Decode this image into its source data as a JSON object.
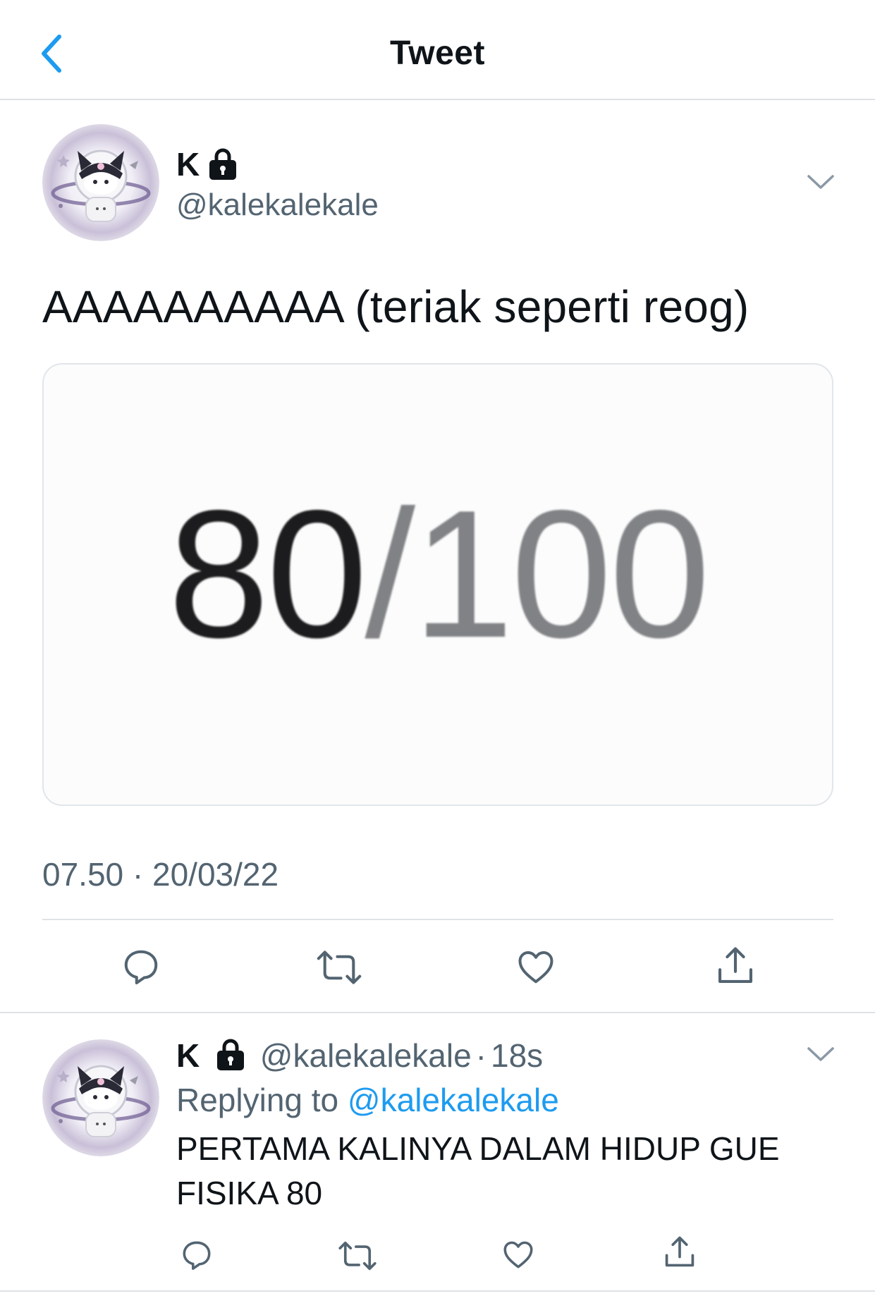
{
  "header": {
    "title": "Tweet",
    "back_icon": "chevron-left-icon"
  },
  "main_tweet": {
    "display_name": "K",
    "handle": "@kalekalekale",
    "text": "AAAAAAAAAA (teriak seperti reog)",
    "media": {
      "score": "80",
      "slash_total": "/100"
    },
    "timestamp": "07.50 · 20/03/22",
    "actions": [
      "reply-icon",
      "retweet-icon",
      "like-icon",
      "share-icon"
    ]
  },
  "reply_tweet": {
    "display_name": "K",
    "handle": "@kalekalekale",
    "separator": "·",
    "time": "18s",
    "replying_label": "Replying to",
    "replying_to": "@kalekalekale",
    "text": "PERTAMA KALINYA DALAM HIDUP GUE FISIKA 80",
    "actions": [
      "reply-icon",
      "retweet-icon",
      "like-icon",
      "share-icon"
    ]
  },
  "colors": {
    "accent": "#1d9bf0",
    "secondary_text": "#536471",
    "divider": "#dfe3e7"
  }
}
